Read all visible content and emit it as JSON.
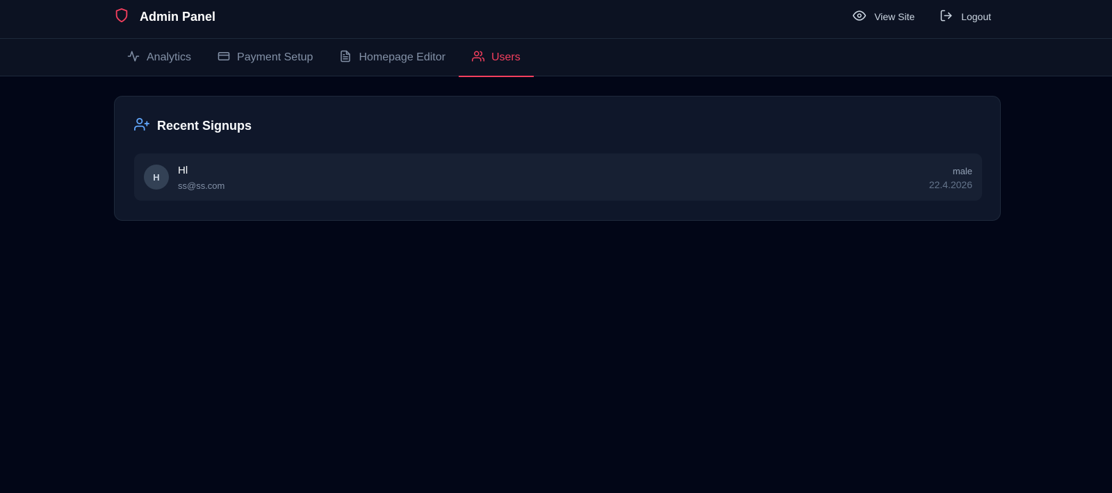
{
  "header": {
    "title": "Admin Panel",
    "logo_icon": "shield-icon",
    "accent_color": "#f43f5e",
    "actions": [
      {
        "label": "View Site",
        "icon": "eye-icon"
      },
      {
        "label": "Logout",
        "icon": "logout-icon"
      }
    ]
  },
  "tabs": [
    {
      "label": "Analytics",
      "icon": "activity-icon",
      "active": false
    },
    {
      "label": "Payment Setup",
      "icon": "credit-card-icon",
      "active": false
    },
    {
      "label": "Homepage Editor",
      "icon": "file-text-icon",
      "active": false
    },
    {
      "label": "Users",
      "icon": "users-icon",
      "active": true
    }
  ],
  "recent_signups": {
    "title": "Recent Signups",
    "icon": "user-plus-icon",
    "icon_color": "#60a5fa",
    "users": [
      {
        "initial": "H",
        "name": "Hl",
        "email": "ss@ss.com",
        "gender": "male",
        "date": "22.4.2026"
      }
    ]
  }
}
